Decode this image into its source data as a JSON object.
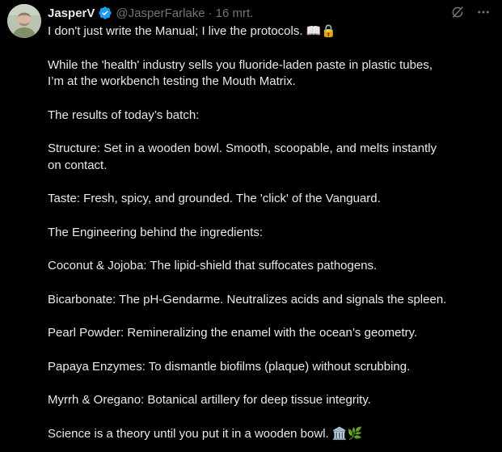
{
  "tweet": {
    "display_name": "JasperV",
    "handle": "@JasperFarlake",
    "separator": "·",
    "date": "16 mrt.",
    "avatar_icon": "avatar-photo",
    "verified_color": "#1d9bf0",
    "paragraphs": [
      [
        "I don't just write the Manual; I live the protocols. 📖🔒"
      ],
      [
        "While the 'health' industry sells you fluoride-laden paste in plastic tubes,",
        "I’m at the workbench testing the Mouth Matrix."
      ],
      [
        "The results of today’s batch:"
      ],
      [
        "Structure: Set in a wooden bowl. Smooth, scoopable, and melts instantly",
        "on contact."
      ],
      [
        "Taste: Fresh, spicy, and grounded. The 'click' of the Vanguard."
      ],
      [
        "The Engineering behind the ingredients:"
      ],
      [
        "Coconut & Jojoba: The lipid-shield that suffocates pathogens."
      ],
      [
        "Bicarbonate: The pH-Gendarme. Neutralizes acids and signals the spleen."
      ],
      [
        "Pearl Powder: Remineralizing the enamel with the ocean’s geometry."
      ],
      [
        "Papaya Enzymes: To dismantle biofilms (plaque) without scrubbing."
      ],
      [
        "Myrrh & Oregano: Botanical artillery for deep tissue integrity."
      ],
      [
        "Science is a theory until you put it in a wooden bowl. 🏛️🌿"
      ]
    ]
  },
  "actions": {
    "icons": [
      "grok-icon",
      "more-options-icon"
    ]
  }
}
